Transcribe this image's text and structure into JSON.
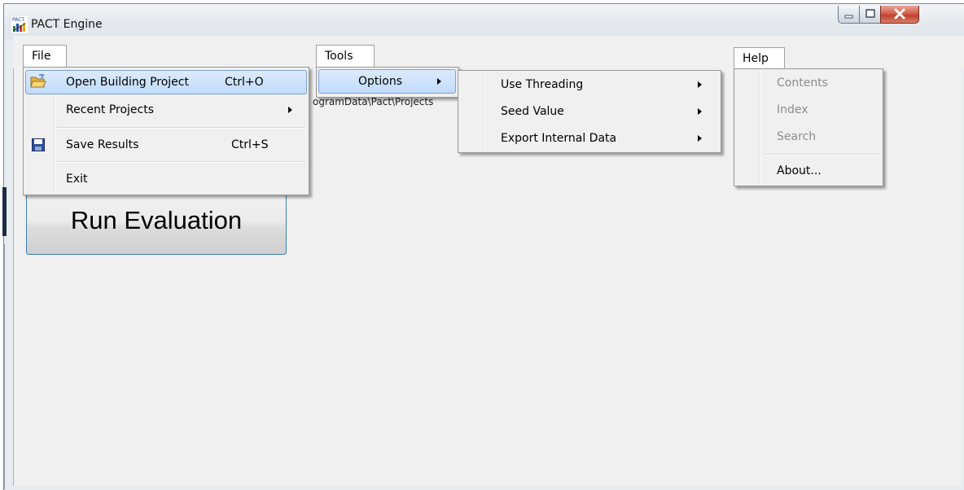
{
  "window": {
    "title": "PACT Engine",
    "app_icon_label": "PACT"
  },
  "menubar": {
    "file": "File",
    "tools": "Tools",
    "help": "Help"
  },
  "file_menu": {
    "items": [
      {
        "label": "Open Building Project",
        "shortcut": "Ctrl+O",
        "icon": "open-folder-icon"
      },
      {
        "label": "Recent Projects",
        "shortcut": "",
        "icon": ""
      },
      {
        "label": "Save Results",
        "shortcut": "Ctrl+S",
        "icon": "floppy-disk-icon"
      },
      {
        "label": "Exit",
        "shortcut": "",
        "icon": ""
      }
    ]
  },
  "tools_menu": {
    "items": [
      {
        "label": "Options"
      }
    ]
  },
  "options_submenu": {
    "items": [
      {
        "label": "Use Threading"
      },
      {
        "label": "Seed Value"
      },
      {
        "label": "Export Internal Data"
      }
    ]
  },
  "help_menu": {
    "items": [
      {
        "label": "Contents",
        "enabled": false
      },
      {
        "label": "Index",
        "enabled": false
      },
      {
        "label": "Search",
        "enabled": false
      },
      {
        "label": "About...",
        "enabled": true
      }
    ]
  },
  "background": {
    "path_fragment": "ogramData\\Pact\\Projects"
  },
  "main": {
    "run_button": "Run Evaluation"
  },
  "colors": {
    "highlight_border": "#7da2ce",
    "highlight_fill": "#c1dbfc",
    "run_button_border": "#3c7fb1"
  }
}
